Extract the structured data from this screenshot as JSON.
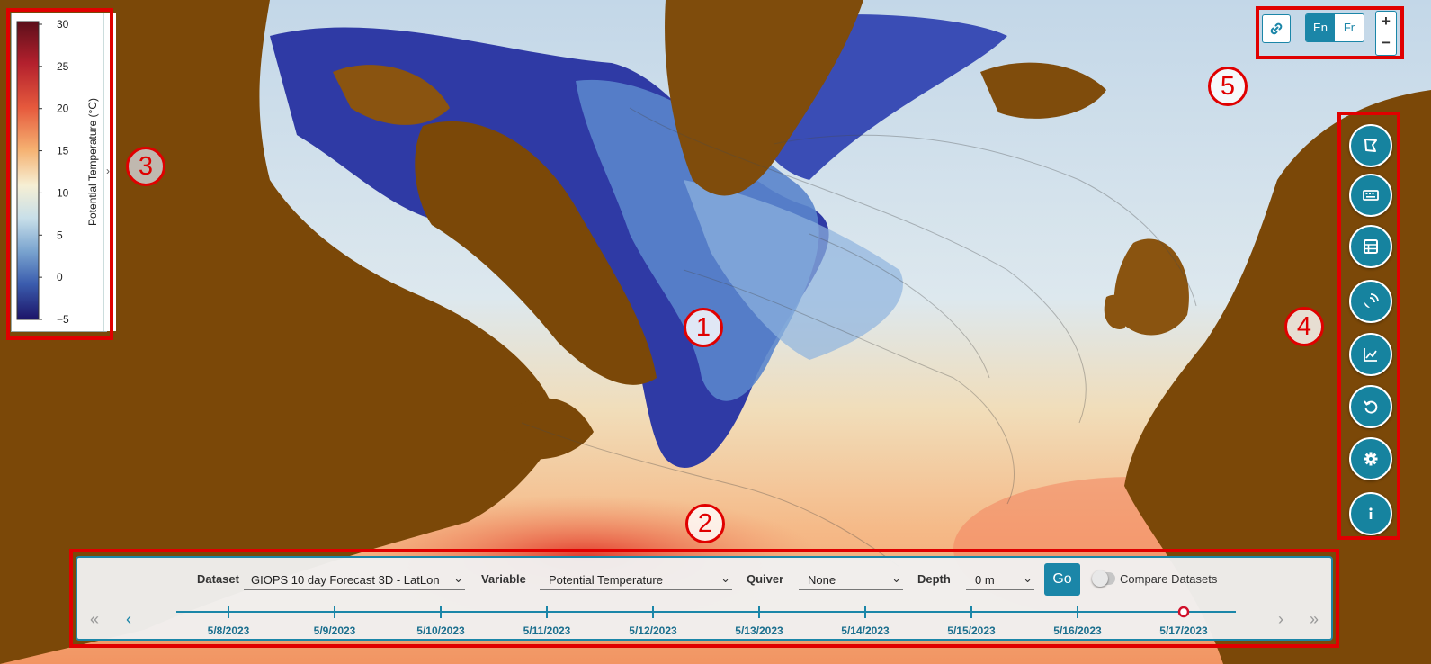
{
  "map": {
    "colors": {
      "land": "#7a4707",
      "deep_blue": "#2a2f9a",
      "light_ocean": "#dbe8f0",
      "warm": "#f2a271",
      "hot": "#e54432"
    }
  },
  "legend": {
    "label": "Potential Temperature (°C)",
    "ticks": [
      "30",
      "25",
      "20",
      "15",
      "10",
      "5",
      "0",
      "−5"
    ],
    "toggle_icon": "chevron-right-icon",
    "toggle_glyph": "›"
  },
  "callouts": [
    "1",
    "2",
    "3",
    "4",
    "5"
  ],
  "top_controls": {
    "link_icon": "link-icon",
    "lang_en": "En",
    "lang_fr": "Fr",
    "zoom_in": "+",
    "zoom_out": "−"
  },
  "toolbar": {
    "buttons": [
      "draw-area-icon",
      "keyboard-icon",
      "table-icon",
      "satellite-icon",
      "line-chart-icon",
      "reset-icon",
      "gear-icon",
      "info-icon"
    ]
  },
  "panel": {
    "dataset_label": "Dataset",
    "dataset_value": "GIOPS 10 day Forecast 3D - LatLon",
    "variable_label": "Variable",
    "variable_value": "Potential Temperature",
    "quiver_label": "Quiver",
    "quiver_value": "None",
    "depth_label": "Depth",
    "depth_value": "0 m",
    "go_label": "Go",
    "compare_label": "Compare Datasets",
    "first_glyph": "«",
    "prev_glyph": "‹",
    "next_glyph": "›",
    "last_glyph": "»",
    "dates": [
      "5/8/2023",
      "5/9/2023",
      "5/10/2023",
      "5/11/2023",
      "5/12/2023",
      "5/13/2023",
      "5/14/2023",
      "5/15/2023",
      "5/16/2023",
      "5/17/2023"
    ],
    "selected_date": "5/17/2023"
  }
}
